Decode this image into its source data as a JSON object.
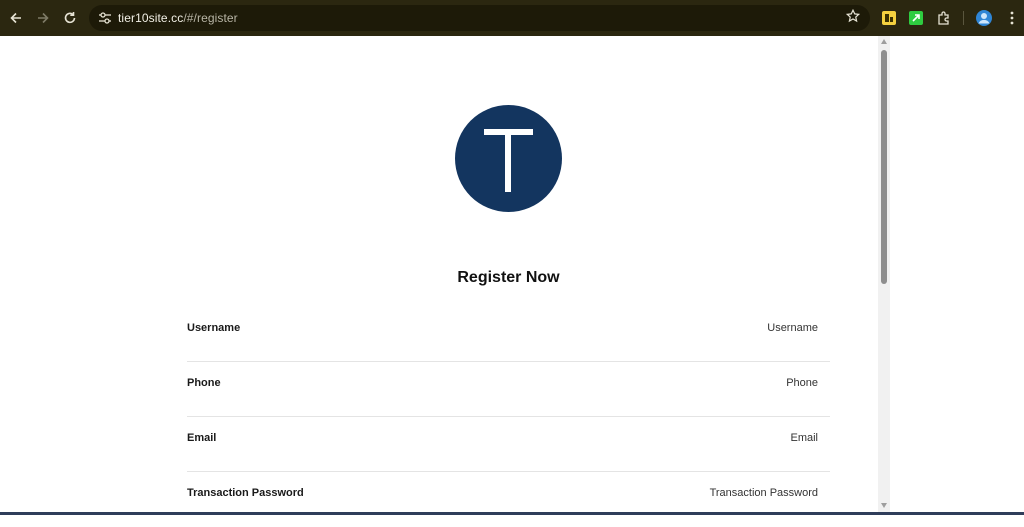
{
  "browser": {
    "url_host": "tier10site.cc",
    "url_path": "/#/register",
    "back_icon": "arrow-left-icon",
    "forward_icon": "arrow-right-icon",
    "reload_icon": "reload-icon",
    "bookmark_icon": "star-icon",
    "extensions": [
      "yellow-extension-icon",
      "green-extension-icon",
      "puzzle-extension-icon",
      "profile-avatar-icon",
      "menu-kebab-icon"
    ]
  },
  "page": {
    "logo_letter": "T",
    "logo_color": "#13355f",
    "title": "Register Now",
    "fields": [
      {
        "label": "Username",
        "placeholder": "Username"
      },
      {
        "label": "Phone",
        "placeholder": "Phone"
      },
      {
        "label": "Email",
        "placeholder": "Email"
      },
      {
        "label": "Transaction Password",
        "placeholder": "Transaction Password"
      }
    ]
  }
}
